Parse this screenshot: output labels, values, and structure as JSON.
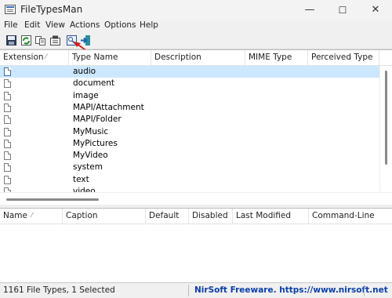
{
  "window": {
    "title": "FileTypesMan",
    "minimize": "—",
    "maximize": "☐",
    "close": "✕"
  },
  "menu": [
    "File",
    "Edit",
    "View",
    "Actions",
    "Options",
    "Help"
  ],
  "toolbar_icons": [
    "save-icon",
    "refresh-icon",
    "copy-icon",
    "properties-icon",
    "html-report-icon",
    "exit-icon"
  ],
  "upper_table": {
    "columns": [
      "Extension",
      "Type Name",
      "Description",
      "MIME Type",
      "Perceived Type"
    ],
    "sort_arrow": "⁄",
    "rows": [
      "audio",
      "document",
      "image",
      "MAPI/Attachment",
      "MAPI/Folder",
      "MyMusic",
      "MyPictures",
      "MyVideo",
      "system",
      "text",
      "video"
    ],
    "selected_row": 0
  },
  "lower_table": {
    "columns": [
      "Name",
      "Caption",
      "Default",
      "Disabled",
      "Last Modified",
      "Command-Line"
    ],
    "sort_arrow": "⁄"
  },
  "status": {
    "left": "1161 File Types, 1 Selected",
    "right": "NirSoft Freeware. https://www.nirsoft.net"
  },
  "colors": {
    "accent": "#cc1f1f",
    "link": "#0a3fa6",
    "selection": "#cce8ff"
  }
}
